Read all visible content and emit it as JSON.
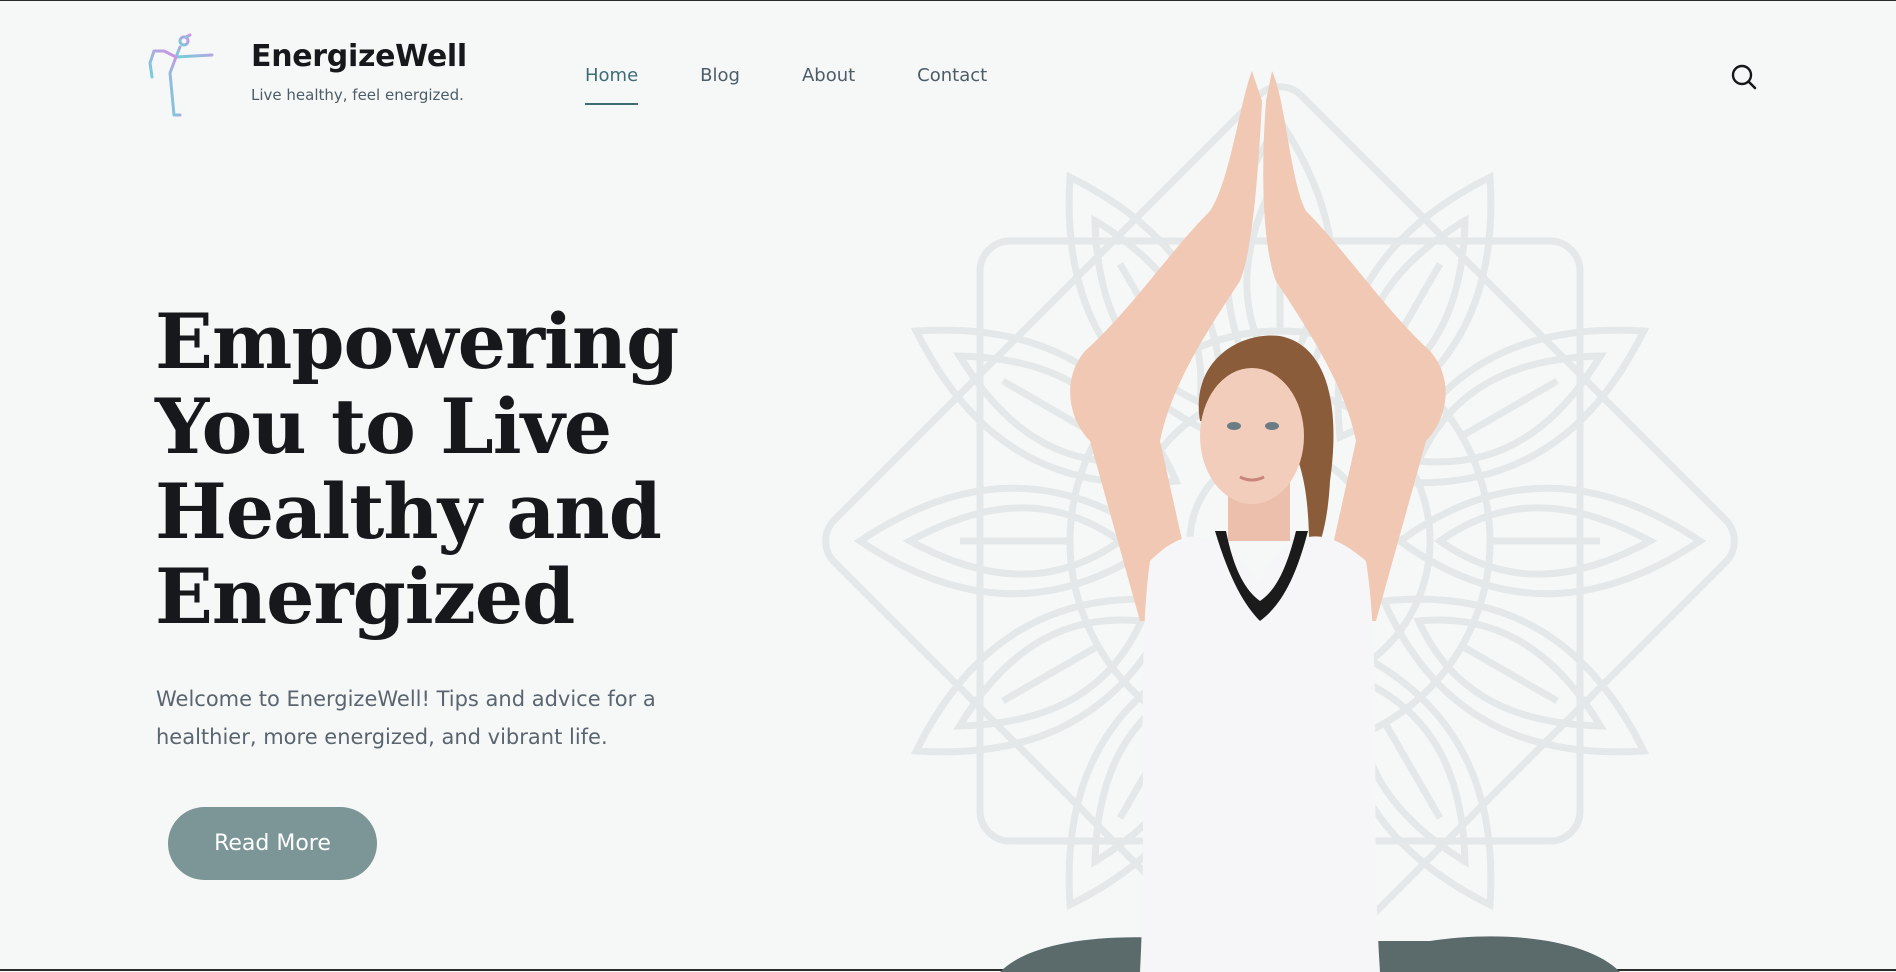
{
  "header": {
    "title": "EnergizeWell",
    "tagline": "Live healthy, feel energized."
  },
  "nav": {
    "items": [
      {
        "label": "Home",
        "active": true
      },
      {
        "label": "Blog",
        "active": false
      },
      {
        "label": "About",
        "active": false
      },
      {
        "label": "Contact",
        "active": false
      }
    ]
  },
  "search": {
    "icon": "search-icon"
  },
  "hero": {
    "heading_lines": [
      "Empowering",
      "You to Live",
      "Healthy and",
      "Energized"
    ],
    "subtitle": "Welcome to EnergizeWell! Tips and advice for a healthier, more energized, and vibrant life.",
    "button_label": "Read More"
  },
  "colors": {
    "background": "#f6f8f7",
    "accent": "#3e6c73",
    "button": "#7c9596",
    "text_dark": "#16181b",
    "text_muted": "#5a6570"
  }
}
